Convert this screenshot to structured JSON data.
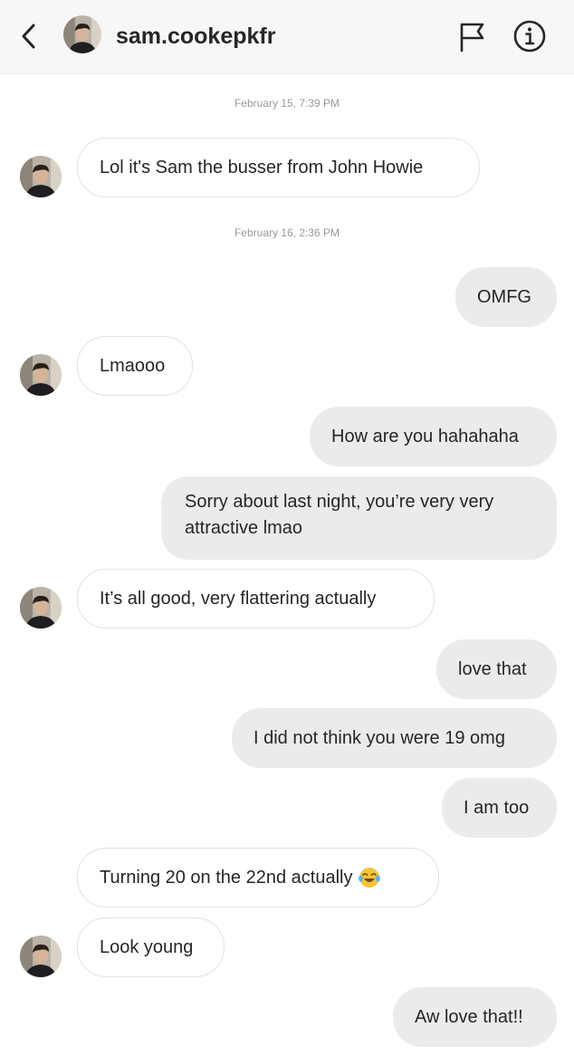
{
  "header": {
    "username": "sam.cookepkfr",
    "back_icon": "chevron-left-icon",
    "flag_icon": "flag-icon",
    "info_icon": "info-icon"
  },
  "conversation": {
    "timestamps": [
      "February 15, 7:39 PM",
      "February 16, 2:36 PM"
    ],
    "messages": [
      {
        "from": "them",
        "text": "Lol it's Sam the busser from John Howie"
      },
      {
        "from": "me",
        "text": "OMFG"
      },
      {
        "from": "them",
        "text": "Lmaooo"
      },
      {
        "from": "me",
        "text": "How are you hahahaha"
      },
      {
        "from": "me",
        "text": "Sorry about last night, you’re very very attractive lmao"
      },
      {
        "from": "them",
        "text": "It’s all good, very flattering actually"
      },
      {
        "from": "me",
        "text": "love that"
      },
      {
        "from": "me",
        "text": "I did not think you were 19 omg"
      },
      {
        "from": "me",
        "text": "I am too"
      },
      {
        "from": "them",
        "text": "Turning 20 on the 22nd actually",
        "emoji": "face-with-tears-of-joy"
      },
      {
        "from": "them",
        "text": "Look young"
      },
      {
        "from": "me",
        "text": "Aw love that!!"
      }
    ]
  },
  "colors": {
    "header_bg": "#f7f7f7",
    "outgoing_bubble": "#ebebeb",
    "incoming_border": "#e2e2e2",
    "timestamp_text": "#9a9a9a",
    "text": "#262626"
  }
}
